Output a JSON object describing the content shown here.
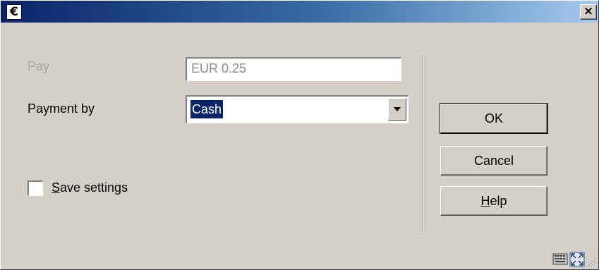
{
  "window": {
    "title_icon_glyph": "€",
    "close_glyph": "×"
  },
  "form": {
    "pay_label": "Pay",
    "pay_value": "EUR 0.25",
    "payment_by_label": "Payment by",
    "payment_by_selected": "Cash",
    "save_settings_mnemonic": "S",
    "save_settings_rest": "ave settings",
    "save_settings_checked": false
  },
  "buttons": {
    "ok_label": "OK",
    "cancel_label": "Cancel",
    "help_mnemonic": "H",
    "help_rest": "elp"
  },
  "statusbar": {
    "icons": [
      "keyboard-icon",
      "fullscreen-icon",
      "resize-grip-icon"
    ]
  },
  "colors": {
    "titlebar_start": "#0a246a",
    "titlebar_end": "#a6caf0",
    "face": "#d4d0c8",
    "selection": "#0a246a"
  }
}
